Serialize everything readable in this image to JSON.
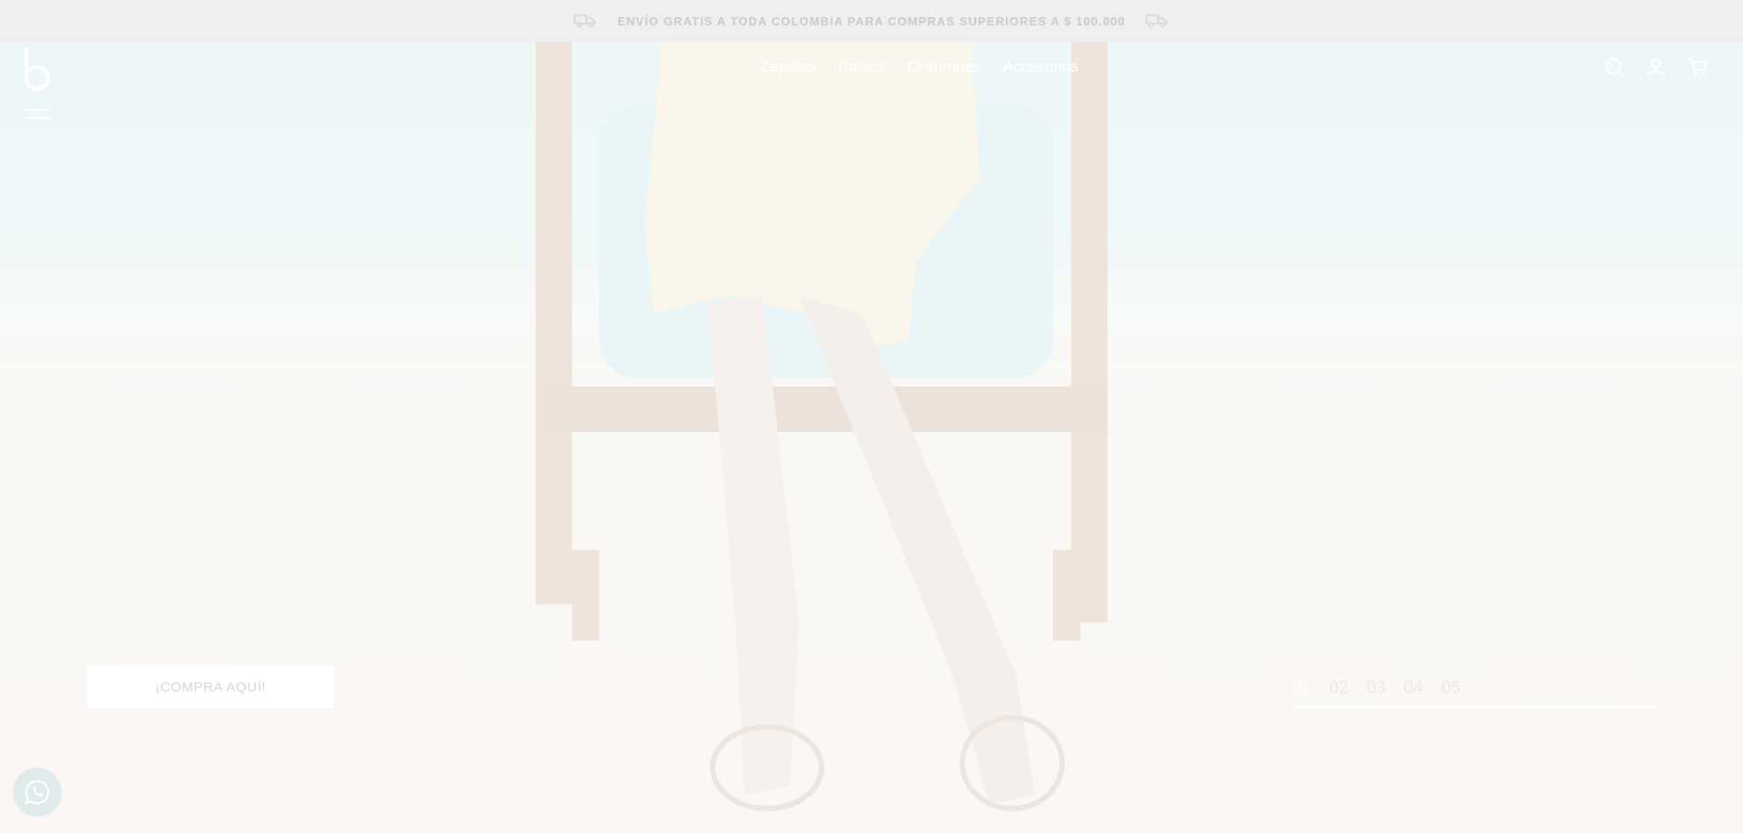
{
  "announcement": {
    "text": "ENVÍO GRATIS A TODA COLOMBIA PARA COMPRAS SUPERIORES A $ 100.000",
    "icon": "delivery-truck-icon"
  },
  "header": {
    "logo_icon": "brand-b-logo",
    "menu_icon": "hamburger-menu-icon",
    "nav": [
      "Zapatos",
      "Bolsos",
      "Cinturones",
      "Accesorios"
    ],
    "icons": [
      "search-icon",
      "user-icon",
      "cart-icon"
    ]
  },
  "hero": {
    "cta_label": "¡COMPRA AQUÍ!",
    "slides": [
      "01",
      "02",
      "03",
      "04",
      "05"
    ],
    "active_slide": "01"
  },
  "whatsapp": {
    "icon": "whatsapp-icon"
  },
  "colors": {
    "topbar_bg": "#efefef",
    "topbar_text": "#c9c9c9",
    "header_text": "#ffffff",
    "cta_bg": "#ffffff"
  }
}
